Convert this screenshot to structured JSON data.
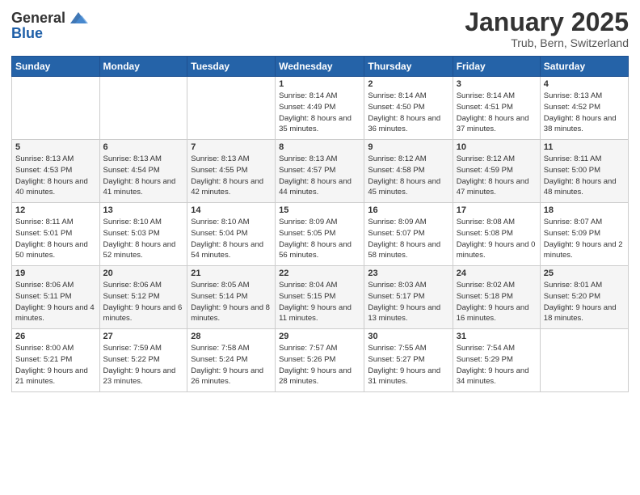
{
  "logo": {
    "general": "General",
    "blue": "Blue"
  },
  "header": {
    "title": "January 2025",
    "subtitle": "Trub, Bern, Switzerland"
  },
  "weekdays": [
    "Sunday",
    "Monday",
    "Tuesday",
    "Wednesday",
    "Thursday",
    "Friday",
    "Saturday"
  ],
  "weeks": [
    [
      {
        "day": "",
        "info": ""
      },
      {
        "day": "",
        "info": ""
      },
      {
        "day": "",
        "info": ""
      },
      {
        "day": "1",
        "info": "Sunrise: 8:14 AM\nSunset: 4:49 PM\nDaylight: 8 hours and 35 minutes."
      },
      {
        "day": "2",
        "info": "Sunrise: 8:14 AM\nSunset: 4:50 PM\nDaylight: 8 hours and 36 minutes."
      },
      {
        "day": "3",
        "info": "Sunrise: 8:14 AM\nSunset: 4:51 PM\nDaylight: 8 hours and 37 minutes."
      },
      {
        "day": "4",
        "info": "Sunrise: 8:13 AM\nSunset: 4:52 PM\nDaylight: 8 hours and 38 minutes."
      }
    ],
    [
      {
        "day": "5",
        "info": "Sunrise: 8:13 AM\nSunset: 4:53 PM\nDaylight: 8 hours and 40 minutes."
      },
      {
        "day": "6",
        "info": "Sunrise: 8:13 AM\nSunset: 4:54 PM\nDaylight: 8 hours and 41 minutes."
      },
      {
        "day": "7",
        "info": "Sunrise: 8:13 AM\nSunset: 4:55 PM\nDaylight: 8 hours and 42 minutes."
      },
      {
        "day": "8",
        "info": "Sunrise: 8:13 AM\nSunset: 4:57 PM\nDaylight: 8 hours and 44 minutes."
      },
      {
        "day": "9",
        "info": "Sunrise: 8:12 AM\nSunset: 4:58 PM\nDaylight: 8 hours and 45 minutes."
      },
      {
        "day": "10",
        "info": "Sunrise: 8:12 AM\nSunset: 4:59 PM\nDaylight: 8 hours and 47 minutes."
      },
      {
        "day": "11",
        "info": "Sunrise: 8:11 AM\nSunset: 5:00 PM\nDaylight: 8 hours and 48 minutes."
      }
    ],
    [
      {
        "day": "12",
        "info": "Sunrise: 8:11 AM\nSunset: 5:01 PM\nDaylight: 8 hours and 50 minutes."
      },
      {
        "day": "13",
        "info": "Sunrise: 8:10 AM\nSunset: 5:03 PM\nDaylight: 8 hours and 52 minutes."
      },
      {
        "day": "14",
        "info": "Sunrise: 8:10 AM\nSunset: 5:04 PM\nDaylight: 8 hours and 54 minutes."
      },
      {
        "day": "15",
        "info": "Sunrise: 8:09 AM\nSunset: 5:05 PM\nDaylight: 8 hours and 56 minutes."
      },
      {
        "day": "16",
        "info": "Sunrise: 8:09 AM\nSunset: 5:07 PM\nDaylight: 8 hours and 58 minutes."
      },
      {
        "day": "17",
        "info": "Sunrise: 8:08 AM\nSunset: 5:08 PM\nDaylight: 9 hours and 0 minutes."
      },
      {
        "day": "18",
        "info": "Sunrise: 8:07 AM\nSunset: 5:09 PM\nDaylight: 9 hours and 2 minutes."
      }
    ],
    [
      {
        "day": "19",
        "info": "Sunrise: 8:06 AM\nSunset: 5:11 PM\nDaylight: 9 hours and 4 minutes."
      },
      {
        "day": "20",
        "info": "Sunrise: 8:06 AM\nSunset: 5:12 PM\nDaylight: 9 hours and 6 minutes."
      },
      {
        "day": "21",
        "info": "Sunrise: 8:05 AM\nSunset: 5:14 PM\nDaylight: 9 hours and 8 minutes."
      },
      {
        "day": "22",
        "info": "Sunrise: 8:04 AM\nSunset: 5:15 PM\nDaylight: 9 hours and 11 minutes."
      },
      {
        "day": "23",
        "info": "Sunrise: 8:03 AM\nSunset: 5:17 PM\nDaylight: 9 hours and 13 minutes."
      },
      {
        "day": "24",
        "info": "Sunrise: 8:02 AM\nSunset: 5:18 PM\nDaylight: 9 hours and 16 minutes."
      },
      {
        "day": "25",
        "info": "Sunrise: 8:01 AM\nSunset: 5:20 PM\nDaylight: 9 hours and 18 minutes."
      }
    ],
    [
      {
        "day": "26",
        "info": "Sunrise: 8:00 AM\nSunset: 5:21 PM\nDaylight: 9 hours and 21 minutes."
      },
      {
        "day": "27",
        "info": "Sunrise: 7:59 AM\nSunset: 5:22 PM\nDaylight: 9 hours and 23 minutes."
      },
      {
        "day": "28",
        "info": "Sunrise: 7:58 AM\nSunset: 5:24 PM\nDaylight: 9 hours and 26 minutes."
      },
      {
        "day": "29",
        "info": "Sunrise: 7:57 AM\nSunset: 5:26 PM\nDaylight: 9 hours and 28 minutes."
      },
      {
        "day": "30",
        "info": "Sunrise: 7:55 AM\nSunset: 5:27 PM\nDaylight: 9 hours and 31 minutes."
      },
      {
        "day": "31",
        "info": "Sunrise: 7:54 AM\nSunset: 5:29 PM\nDaylight: 9 hours and 34 minutes."
      },
      {
        "day": "",
        "info": ""
      }
    ]
  ]
}
